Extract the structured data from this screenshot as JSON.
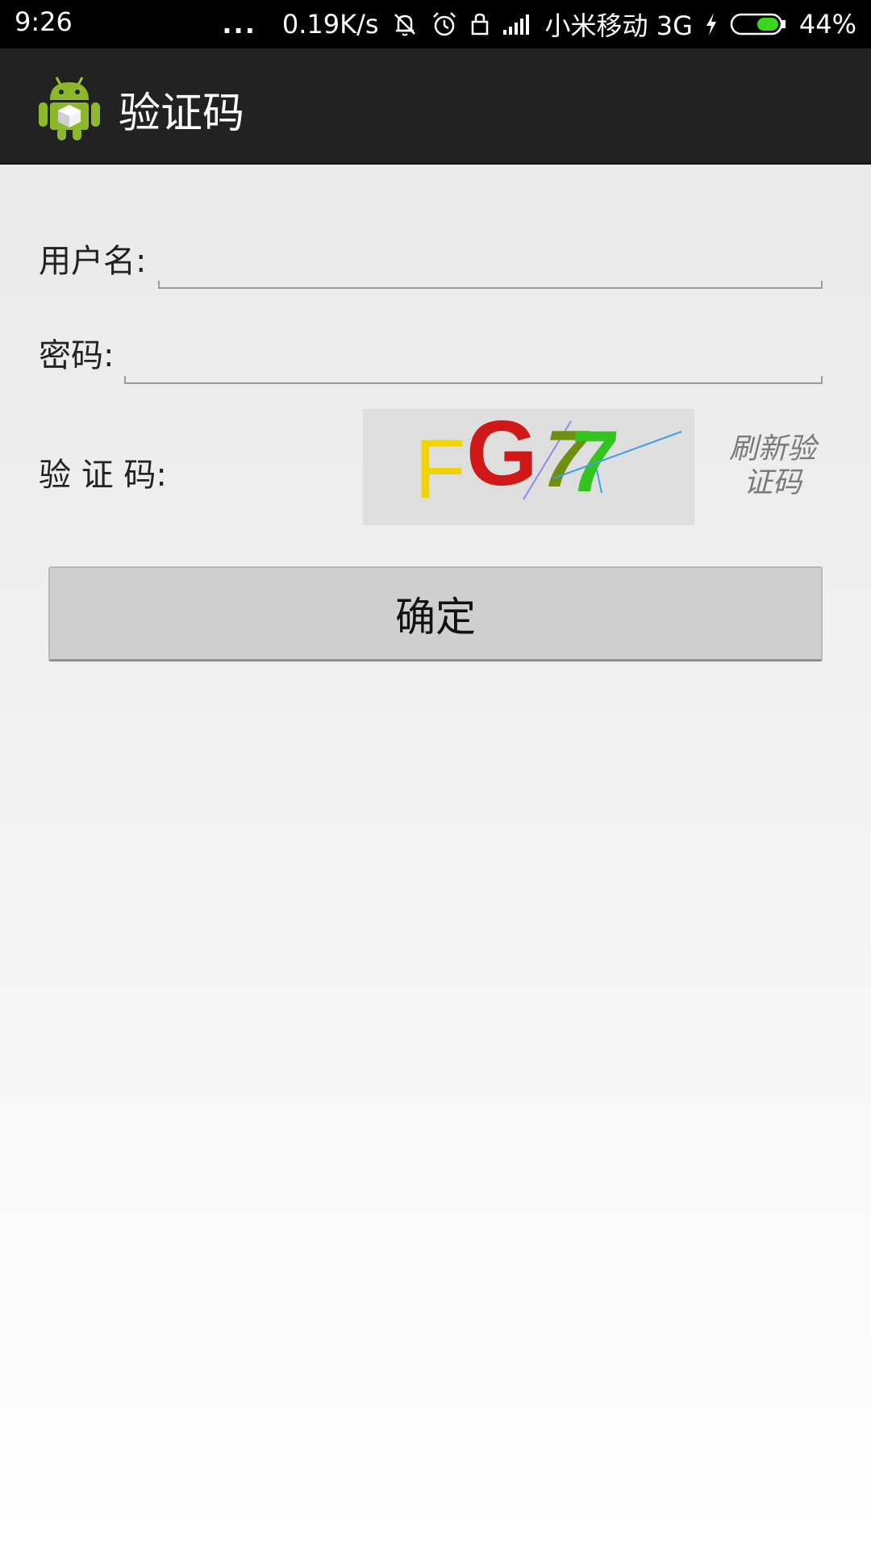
{
  "status_bar": {
    "time": "9:26",
    "dots": "...",
    "network_speed": "0.19K/s",
    "carrier": "小米移动 3G",
    "battery": "44%",
    "battery_level": 0.44,
    "icons": [
      "mute-icon",
      "alarm-icon",
      "lock-icon",
      "signal-icon",
      "charging-icon",
      "battery-icon"
    ]
  },
  "action_bar": {
    "title": "验证码",
    "icon": "android-app-icon"
  },
  "form": {
    "username_label": "用户名:",
    "username_value": "",
    "password_label": "密码:",
    "password_value": "",
    "captcha_label": "验 证 码:",
    "captcha_text": "FG77",
    "refresh_label": "刷新验证码"
  },
  "confirm_button": {
    "label": "确定"
  },
  "colors": {
    "status_bar": "#000000",
    "action_bar": "#222222",
    "button": "#cfcfcf",
    "captcha_bg": "#dedede",
    "captcha_f": "#f0d400",
    "captcha_g": "#d01818",
    "captcha_7a": "#6f8f10",
    "captcha_7b": "#34c420"
  }
}
